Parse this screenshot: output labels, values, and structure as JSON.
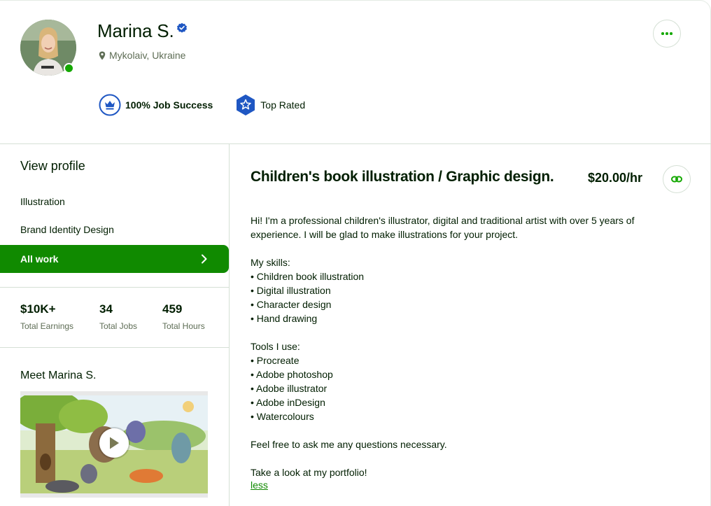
{
  "profile": {
    "name": "Marina S.",
    "location": "Mykolaiv, Ukraine",
    "job_success": "100% Job Success",
    "top_rated": "Top Rated"
  },
  "sidebar": {
    "view_profile": "View profile",
    "items": [
      {
        "label": "Illustration"
      },
      {
        "label": "Brand Identity Design"
      },
      {
        "label": "All work"
      }
    ]
  },
  "stats": [
    {
      "value": "$10K+",
      "label": "Total Earnings"
    },
    {
      "value": "34",
      "label": "Total Jobs"
    },
    {
      "value": "459",
      "label": "Total Hours"
    }
  ],
  "meet": {
    "title": "Meet Marina S."
  },
  "main": {
    "title": "Children's book illustration / Graphic design.",
    "rate": "$20.00/hr",
    "description": {
      "intro_1": "Hi! I'm a professional children's illustrator, digital and traditional artist with over 5 years of",
      "intro_2": "experience. I will be glad to make illustrations for your project.",
      "skills_heading": "My skills:",
      "skills": [
        "• Children book illustration",
        "• Digital illustration",
        "• Character design",
        "• Hand drawing"
      ],
      "tools_heading": "Tools I use:",
      "tools": [
        "• Procreate",
        "• Adobe photoshop",
        "• Adobe illustrator",
        "• Adobe inDesign",
        "• Watercolours"
      ],
      "closing_1": "Feel free to ask me any questions necessary.",
      "closing_2": "Take a look at my portfolio!"
    },
    "less_link": "less"
  },
  "colors": {
    "brand_green": "#14a800",
    "active_green": "#108a00",
    "text_dark": "#001e00",
    "text_muted": "#5e6d55",
    "badge_blue": "#1f57c3"
  },
  "icons": {
    "verified": "verified-badge-icon",
    "location": "map-pin-icon",
    "more": "more-dots-icon",
    "job_success": "crown-icon",
    "top_rated": "star-shield-icon",
    "chevron": "chevron-right-icon",
    "link": "link-icon",
    "play": "play-icon"
  }
}
